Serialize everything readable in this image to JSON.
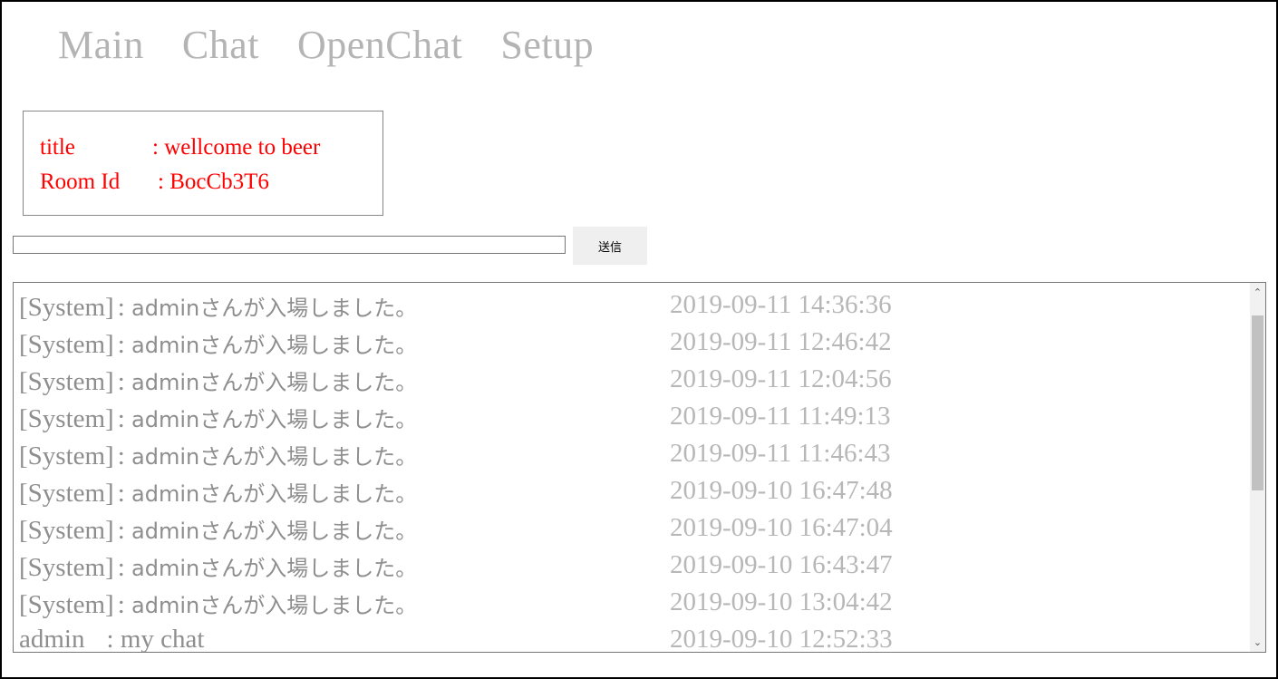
{
  "nav": {
    "items": [
      {
        "label": "Main"
      },
      {
        "label": "Chat"
      },
      {
        "label": "OpenChat"
      },
      {
        "label": "Setup"
      }
    ]
  },
  "room": {
    "title_label": "title",
    "title_value": ": wellcome to beer",
    "id_label": "Room Id",
    "id_value": ": BocCb3T6"
  },
  "composer": {
    "input_value": "",
    "send_label": "送信"
  },
  "chat": {
    "messages": [
      {
        "sender": "[System]",
        "text": "adminさんが入場しました。",
        "time": "2019-09-11 14:36:36"
      },
      {
        "sender": "[System]",
        "text": "adminさんが入場しました。",
        "time": "2019-09-11 12:46:42"
      },
      {
        "sender": "[System]",
        "text": "adminさんが入場しました。",
        "time": "2019-09-11 12:04:56"
      },
      {
        "sender": "[System]",
        "text": "adminさんが入場しました。",
        "time": "2019-09-11 11:49:13"
      },
      {
        "sender": "[System]",
        "text": "adminさんが入場しました。",
        "time": "2019-09-11 11:46:43"
      },
      {
        "sender": "[System]",
        "text": "adminさんが入場しました。",
        "time": "2019-09-10 16:47:48"
      },
      {
        "sender": "[System]",
        "text": "adminさんが入場しました。",
        "time": "2019-09-10 16:47:04"
      },
      {
        "sender": "[System]",
        "text": "adminさんが入場しました。",
        "time": "2019-09-10 16:43:47"
      },
      {
        "sender": "[System]",
        "text": "adminさんが入場しました。",
        "time": "2019-09-10 13:04:42"
      },
      {
        "sender": "admin",
        "text": "my chat",
        "time": "2019-09-10 12:52:33"
      }
    ]
  },
  "icons": {
    "scroll_up": "chevron-up-icon",
    "scroll_down": "chevron-down-icon"
  },
  "colors": {
    "nav_text": "#b4b4b4",
    "room_text": "#ff0000",
    "sender_text": "#8e8e8e",
    "time_text": "#b7b7b7"
  }
}
